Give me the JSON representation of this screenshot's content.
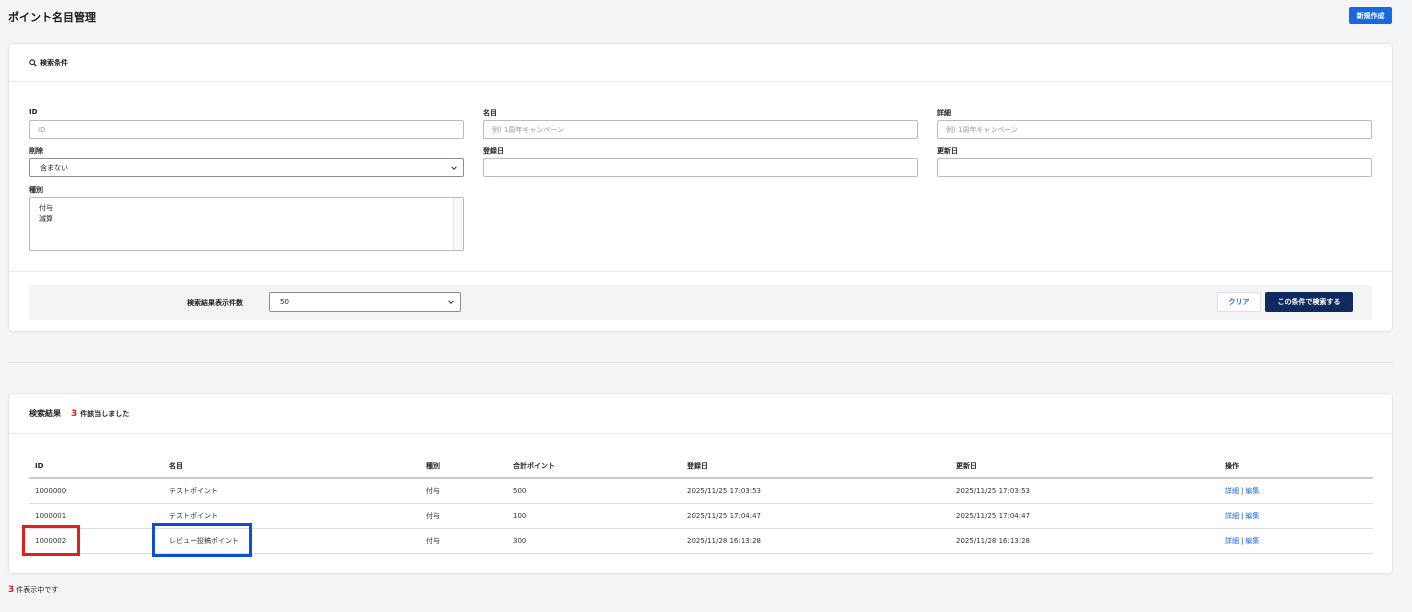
{
  "header": {
    "title": "ポイント名目管理",
    "new_button": "新規作成"
  },
  "search": {
    "title": "検索条件",
    "fields": {
      "id": {
        "label": "ID",
        "placeholder": "ID"
      },
      "name": {
        "label": "名目",
        "placeholder": "例) 1周年キャンペーン"
      },
      "detail": {
        "label": "詳細",
        "placeholder": "例) 1周年キャンペーン"
      },
      "deleted": {
        "label": "削除",
        "value": "含まない"
      },
      "created": {
        "label": "登録日",
        "value": ""
      },
      "updated": {
        "label": "更新日",
        "value": ""
      },
      "type": {
        "label": "種別",
        "options": [
          "付与",
          "減算"
        ]
      }
    },
    "per_page_label": "検索結果表示件数",
    "per_page_value": "50",
    "clear_button": "クリア",
    "search_button": "この条件で検索する"
  },
  "results": {
    "title": "検索結果",
    "count": "3",
    "count_suffix": "件該当しました",
    "columns": [
      "ID",
      "名目",
      "種別",
      "合計ポイント",
      "登録日",
      "更新日",
      "操作"
    ],
    "rows": [
      {
        "id": "1000000",
        "name": "テストポイント",
        "type": "付与",
        "total": "500",
        "created": "2025/11/25 17:03:53",
        "updated": "2025/11/25 17:03:53",
        "detail": "詳細",
        "edit": "編集"
      },
      {
        "id": "1000001",
        "name": "テストポイント",
        "type": "付与",
        "total": "100",
        "created": "2025/11/25 17:04:47",
        "updated": "2025/11/25 17:04:47",
        "detail": "詳細",
        "edit": "編集"
      },
      {
        "id": "1000002",
        "name": "レビュー投稿ポイント",
        "type": "付与",
        "total": "300",
        "created": "2025/11/28 16:13:28",
        "updated": "2025/11/28 16:13:28",
        "detail": "詳細",
        "edit": "編集"
      }
    ]
  },
  "footer": {
    "count": "3",
    "suffix": "件表示中です"
  },
  "colors": {
    "primary": "#1769e0",
    "navy": "#0e2a5e",
    "count_red": "#d02020",
    "highlight_red": "#e02020",
    "highlight_blue": "#0c4fd6"
  }
}
